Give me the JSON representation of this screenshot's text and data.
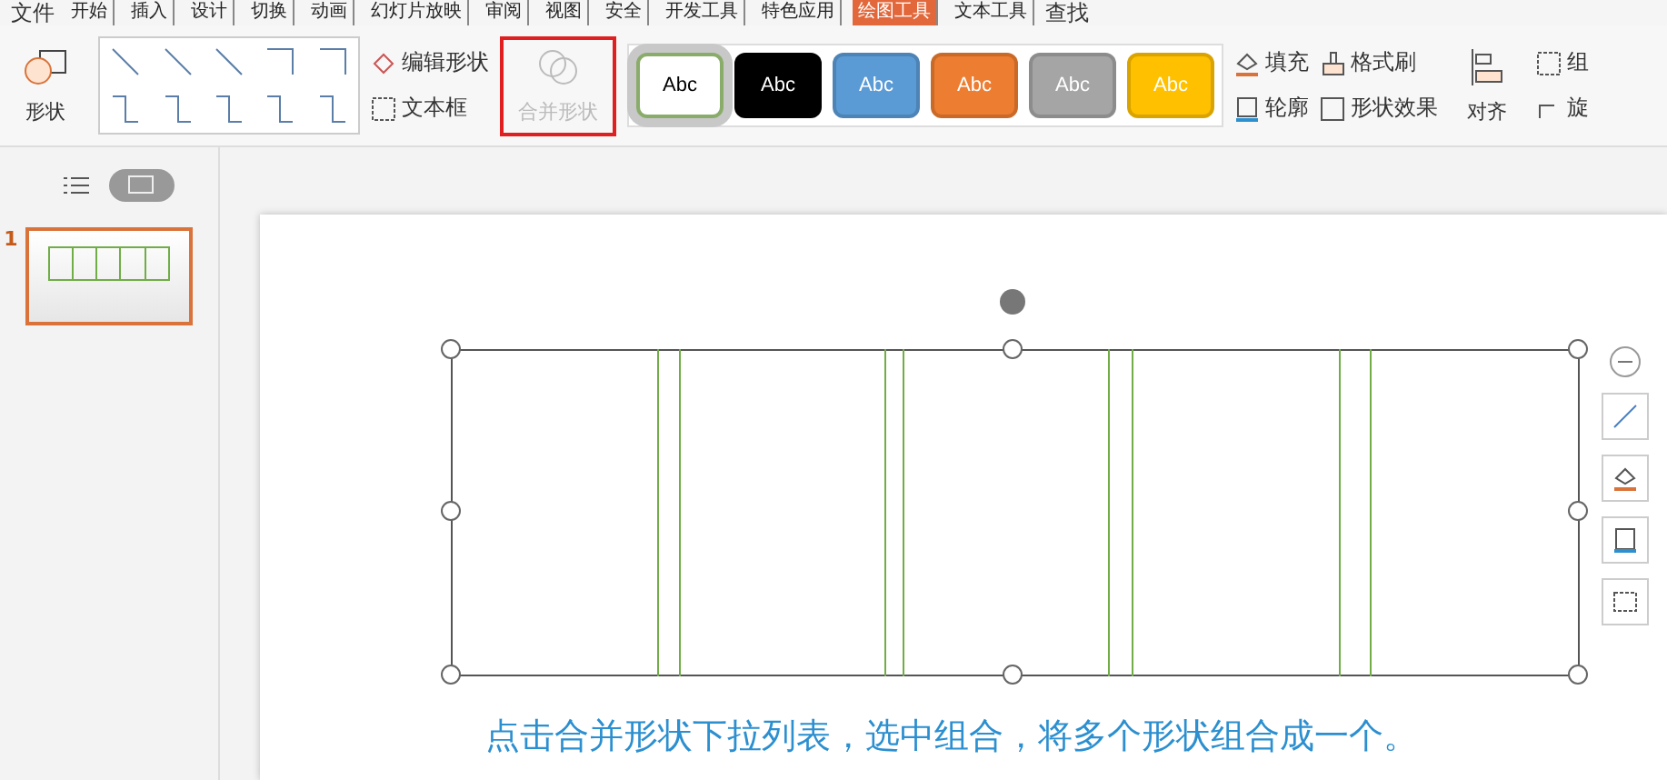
{
  "menu": {
    "file": "文件",
    "tabs": [
      {
        "label": "开始",
        "selected": false
      },
      {
        "label": "插入",
        "selected": false
      },
      {
        "label": "设计",
        "selected": false
      },
      {
        "label": "切换",
        "selected": false
      },
      {
        "label": "动画",
        "selected": false
      },
      {
        "label": "幻灯片放映",
        "selected": false
      },
      {
        "label": "审阅",
        "selected": false
      },
      {
        "label": "视图",
        "selected": false
      },
      {
        "label": "安全",
        "selected": false
      },
      {
        "label": "开发工具",
        "selected": false
      },
      {
        "label": "特色应用",
        "selected": false
      },
      {
        "label": "绘图工具",
        "selected": true
      },
      {
        "label": "文本工具",
        "selected": false
      }
    ],
    "search": "查找"
  },
  "ribbon": {
    "shapes": "形状",
    "edit_shape": "编辑形状",
    "text_box": "文本框",
    "merge_shapes": {
      "label": "合并形状",
      "disabled": true,
      "highlighted": true
    },
    "styles": [
      {
        "label": "Abc",
        "color": "#ffffff",
        "selected": true
      },
      {
        "label": "Abc",
        "color": "#000000",
        "selected": false
      },
      {
        "label": "Abc",
        "color": "#5b9bd5",
        "selected": false
      },
      {
        "label": "Abc",
        "color": "#ed7d31",
        "selected": false
      },
      {
        "label": "Abc",
        "color": "#a5a5a5",
        "selected": false
      },
      {
        "label": "Abc",
        "color": "#ffc000",
        "selected": false
      }
    ],
    "fill": "填充",
    "outline": "轮廓",
    "format_painter": "格式刷",
    "shape_effects": "形状效果",
    "align": "对齐",
    "group": "组",
    "rotate": "旋"
  },
  "views": [
    {
      "kind": "outline",
      "selected": false
    },
    {
      "kind": "slides",
      "selected": true
    }
  ],
  "slides": [
    {
      "number": "1",
      "selected": true
    }
  ],
  "caption": "点击合并形状下拉列表，选中组合，将多个形状组合成一个。"
}
